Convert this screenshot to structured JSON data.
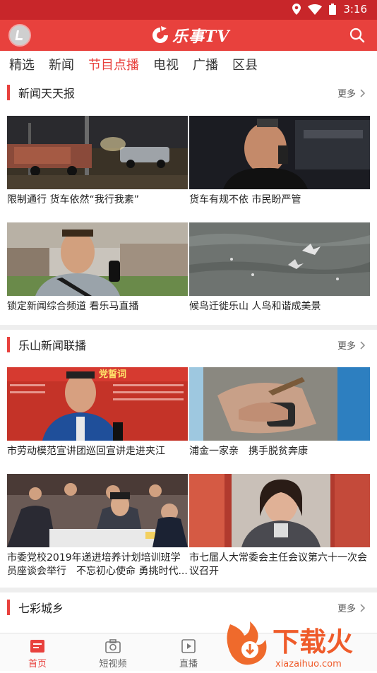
{
  "status": {
    "time": "3:16"
  },
  "header": {
    "app_name": "乐事TV"
  },
  "tabs": [
    "精选",
    "新闻",
    "节目点播",
    "电视",
    "广播",
    "区县"
  ],
  "active_tab": 2,
  "more_label": "更多",
  "sections": [
    {
      "title": "新闻天天报",
      "items": [
        {
          "caption": "限制通行 货车依然“我行我素”",
          "thumb": "night-road-trucks"
        },
        {
          "caption": "货车有规不依 市民盼严管",
          "thumb": "interview-old-man-night"
        },
        {
          "caption": "锁定新闻综合频道 看乐马直播",
          "thumb": "interview-young-man"
        },
        {
          "caption": "候鸟迁徙乐山 人鸟和谐成美景",
          "thumb": "birds-over-river"
        }
      ]
    },
    {
      "title": "乐山新闻联播",
      "items": [
        {
          "caption": "市劳动模范宣讲团巡回宣讲走进夹江",
          "thumb": "speaker-oath-banner",
          "banner_text": "党誓词"
        },
        {
          "caption": "浦金一家亲　携手脱贫奔康",
          "thumb": "hands-craft"
        },
        {
          "caption": "市委党校2019年递进培养计划培训班学员座谈会举行　不忘初心使命 勇挑时代...",
          "thumb": "meeting-room"
        },
        {
          "caption": "市七届人大常委会主任会议第六十一次会议召开",
          "thumb": "woman-speaking"
        }
      ]
    },
    {
      "title": "七彩城乡",
      "items": []
    }
  ],
  "bottom_nav": [
    {
      "label": "首页",
      "icon": "home-icon"
    },
    {
      "label": "短视频",
      "icon": "camera-icon"
    },
    {
      "label": "直播",
      "icon": "play-icon"
    }
  ],
  "watermark": {
    "text": "下载火",
    "url": "xiazaihuo.com"
  },
  "colors": {
    "brand": "#e8413d",
    "status_bar": "#c8262a"
  }
}
